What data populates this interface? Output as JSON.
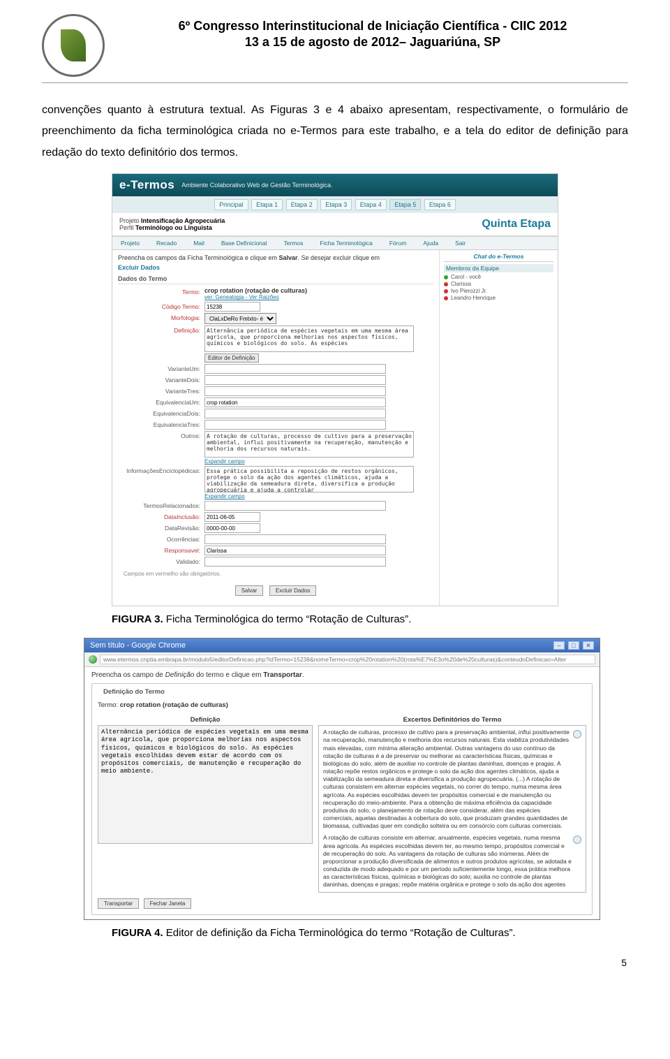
{
  "header": {
    "line1": "6º Congresso Interinstitucional de Iniciação Científica - CIIC 2012",
    "line2": "13 a 15 de agosto de 2012– Jaguariúna, SP"
  },
  "paragraph": "convenções quanto à estrutura textual. As Figuras 3 e 4 abaixo apresentam, respectivamente, o formulário de preenchimento da ficha terminológica criada no e-Termos para este trabalho, e a tela do editor de definição para redação do texto definitório dos termos.",
  "captions": {
    "fig3_label": "FIGURA 3.",
    "fig3_text": " Ficha Terminológica do termo “Rotação de Culturas”.",
    "fig4_label": "FIGURA 4.",
    "fig4_text": " Editor de definição da Ficha Terminológica do termo “Rotação de Culturas”."
  },
  "page_number": "5",
  "etermos": {
    "brand": "e-Termos",
    "brand_sub": "Ambiente Colaborativo Web de Gestão Terminológica.",
    "stages": [
      "Principal",
      "Etapa 1",
      "Etapa 2",
      "Etapa 3",
      "Etapa 4",
      "Etapa 5",
      "Etapa 6"
    ],
    "project_label": "Projeto",
    "project_name": "Intensificação Agropecuária",
    "profile_label": "Perfil",
    "profile_name": "Terminólogo ou Linguista",
    "stage_title": "Quinta Etapa",
    "menu": [
      "Projeto",
      "Recado",
      "Mail",
      "Base Definicional",
      "Termos",
      "Ficha Terminológica",
      "Fórum",
      "Ajuda",
      "Sair"
    ],
    "instr_a": "Preencha os campos da Ficha Terminológica e clique em ",
    "instr_b": "Salvar",
    "instr_c": ". Se desejar excluir clique em",
    "excluir_link": "Excluir Dados",
    "section_dados": "Dados do Termo",
    "fields": {
      "termo_lbl": "Termo:",
      "termo_val": "crop rotation (rotação de culturas)",
      "termo_links": "ver: Genealogia - Ver Raizões",
      "codigo_lbl": "Código Termo:",
      "codigo_val": "15238",
      "morf_lbl": "Morfologia:",
      "morf_val": "ClaLxDeRo Fmtxto- é",
      "def_lbl": "Definição:",
      "def_val": "Alternância periódica de espécies vegetais em uma mesma área agrícola, que proporciona melhorias nos aspectos físicos, químicos e biológicos do solo. As espécies",
      "btn_editor": "Editor de Definição",
      "varUm_lbl": "VarianteUm:",
      "varDois_lbl": "VarianteDois:",
      "varTres_lbl": "VarianteTres:",
      "eqUm_lbl": "EquivalenciaUm:",
      "eqUm_val": "crop rotation",
      "eqDois_lbl": "EquivalenciaDois:",
      "eqTres_lbl": "EquivalenciaTres:",
      "outros_lbl": "Outros:",
      "outros_val": "A rotação de culturas, processo de cultivo para a preservação ambiental, influi positivamente na recuperação, manutenção e melhoria dos recursos naturais.",
      "expandir": "Expandir campo",
      "infoenc_lbl": "InformaçõesEnciclopédicas:",
      "infoenc_val": "Essa prática possibilita a reposição de restos orgânicos, protege o solo da ação dos agentes climáticos, ajuda a viabilização da semeadura direta, diversifica a produção agropecuária e ajuda a controlar",
      "termrel_lbl": "TermosRelacionados:",
      "dataIn_lbl": "DataInclusão:",
      "dataIn_val": "2011-06-05",
      "dataRev_lbl": "DataRevisão:",
      "dataRev_val": "0000-00-00",
      "ocor_lbl": "Ocorrências:",
      "resp_lbl": "Responsavel:",
      "resp_val": "Clarissa",
      "valid_lbl": "Validado:"
    },
    "note": "Campos em vermelho são obrigatórios.",
    "btn_salvar": "Salvar",
    "btn_excluir": "Excluir Dados",
    "chat": {
      "title": "Chat do e-Termos",
      "members_head": "Membros da Equipe",
      "u1": "Carol - você",
      "u2": "Clarissa",
      "u3": "Ivo Pierozzi Jr.",
      "u4": "Leandro Henrique"
    }
  },
  "browser": {
    "win_title": "Sem título - Google Chrome",
    "url": "www.etermos.cnptia.embrapa.br/modulo5/editorDefinicao.php?idTermo=15238&nomeTermo=crop%20rotation%20(rota%E7%E3o%20de%20culturas)&conteudoDefinicao=Alter",
    "instr_a": "Preencha os campo de ",
    "instr_em": "Definição",
    "instr_b": " do termo e clique em ",
    "instr_strong": "Transportar",
    "instr_c": ".",
    "legend": "Definição do Termo",
    "term_lbl": "Termo:",
    "term_val": "crop rotation (rotação de culturas)",
    "col_def": "Definição",
    "col_ex": "Excertos Definitórios do Termo",
    "def_text": "Alternância periódica de espécies vegetais em uma mesma área agrícola, que proporciona melhorias nos aspectos físicos, químicos e biológicos do solo. As espécies vegetais escolhidas devem estar de acordo com os propósitos comerciais, de manutenção e recuperação do meio ambiente.",
    "ex1": "A rotação de culturas, processo de cultivo para a preservação ambiental, influi positivamente na recuperação, manutenção e melhoria dos recursos naturais. Esta viabiliza produtividades mais elevadas, com mínima alteração ambiental. Outras vantagens do uso contínuo da rotação de culturas é a de preservar ou melhorar as características físicas, químicas e biológicas do solo, além de auxiliar no controle de plantas daninhas, doenças e pragas. A rotação repõe restos orgânicos e protege o solo da ação dos agentes climáticos, ajuda a viabilização da semeadura direta e diversifica a produção agropecuária. (...) A rotação de culturas consistem em alternar espécies vegetais, no correr do tempo, numa mesma área agrícola. As espécies escolhidas devem ter propósitos comercial e de manutenção ou recuperação do meio-ambiente. Para a obtenção de máxima eficiência da capacidade produtiva do solo, o planejamento de rotação deve considerar, além das espécies comerciais, aquelas destinadas à cobertura do solo, que produzam grandes quantidades de biomassa, cultivadas quer em condição solteira ou em consórcio com culturas comerciais.",
    "ex2": "A rotação de culturas consiste em alternar, anualmente, espécies vegetais, numa mesma área agrícola. As espécies escolhidas devem ter, ao mesmo tempo, propósitos comercial e de recuperação do solo. As vantagens da rotação de culturas são inúmeras. Além de proporcionar a produção diversificada de alimentos e outros produtos agrícolas, se adotada e conduzida de modo adequado e por um período suficientemente longo, essa prática melhora as características físicas, químicas e biológicas do solo; auxilia no controle de plantas daninhas, doenças e pragas; repõe matéria orgânica e protege o solo da ação dos agentes",
    "btn_trans": "Transportar",
    "btn_close": "Fechar Janela"
  }
}
